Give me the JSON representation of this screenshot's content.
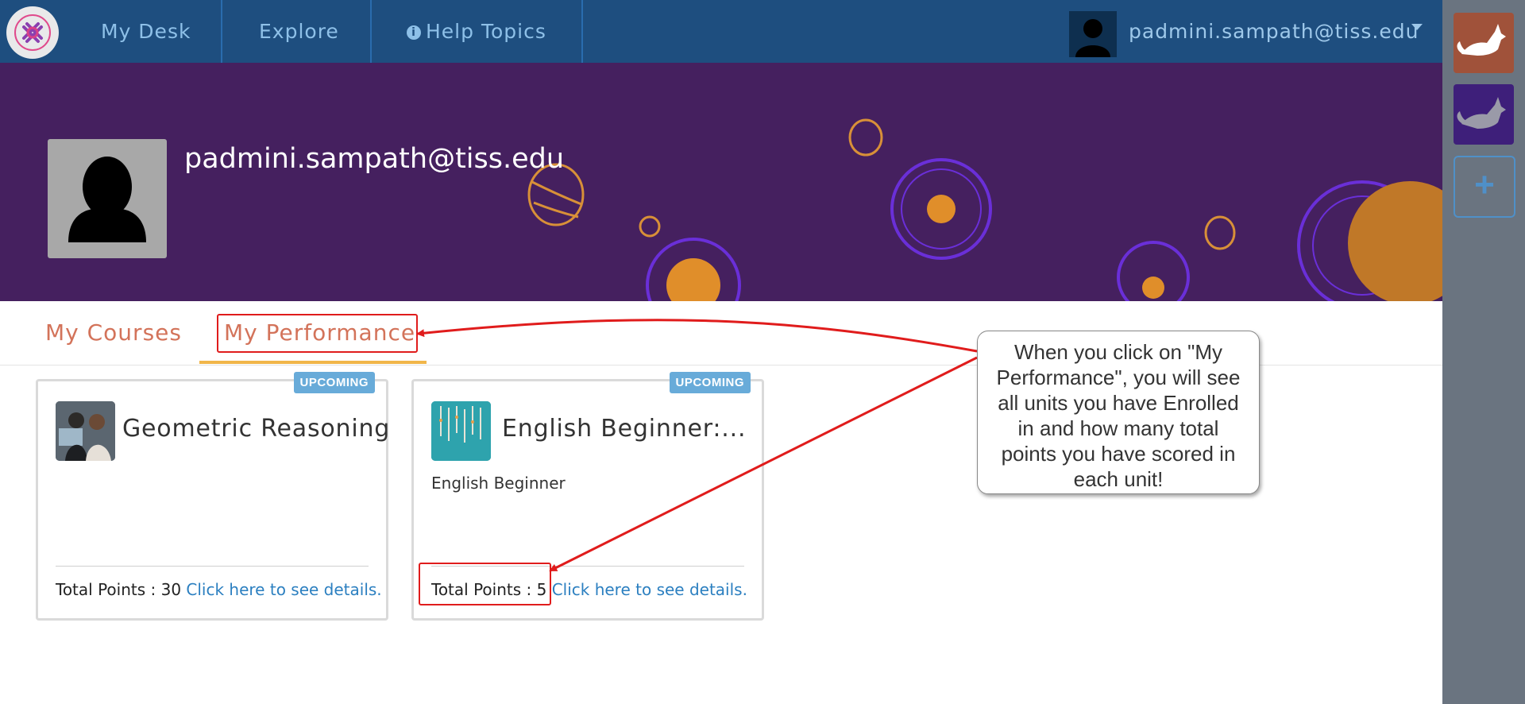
{
  "navbar": {
    "items": [
      {
        "label": "My Desk"
      },
      {
        "label": "Explore"
      },
      {
        "label": "Help Topics",
        "icon": "info-circle-icon"
      }
    ],
    "user_email": "padmini.sampath@tiss.edu"
  },
  "profile": {
    "name": "padmini.sampath@tiss.edu"
  },
  "tabs": [
    {
      "label": "My Courses",
      "active": false
    },
    {
      "label": "My Performance",
      "active": true
    }
  ],
  "cards": [
    {
      "badge": "UPCOMING",
      "title": "Geometric Reasoning",
      "subtitle": "",
      "points_label": "Total Points : 30",
      "link_label": "Click here to see details."
    },
    {
      "badge": "UPCOMING",
      "title": "English Beginner:...",
      "subtitle": "English Beginner",
      "points_label": "Total Points : 5",
      "link_label": "Click here to see details."
    }
  ],
  "callout": {
    "text": "When you click on \"My Performance\", you will see all units you have Enrolled in and how many total points you have scored in each unit!"
  },
  "sidebar": {
    "add_label": "+"
  },
  "colors": {
    "navbar": "#1e4e7f",
    "banner": "#45205f",
    "tab_text": "#d3735a",
    "tab_underline": "#f1b64a",
    "badge": "#68abd9",
    "link": "#2b7fc0",
    "annotation": "#e01c1c"
  }
}
